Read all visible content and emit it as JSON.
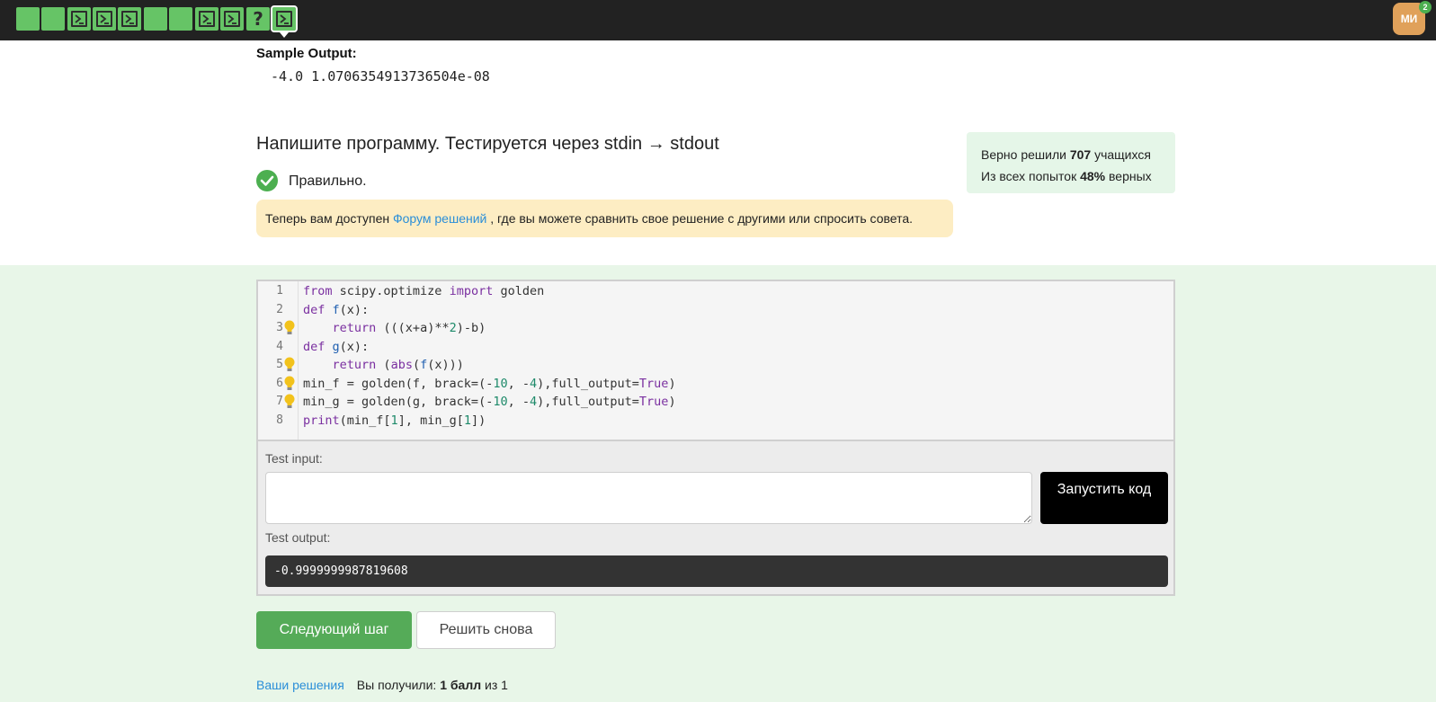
{
  "topbar": {
    "steps": [
      {
        "kind": "text",
        "status": "solved"
      },
      {
        "kind": "text",
        "status": "solved"
      },
      {
        "kind": "code",
        "status": "solved"
      },
      {
        "kind": "code",
        "status": "solved"
      },
      {
        "kind": "code",
        "status": "solved"
      },
      {
        "kind": "text",
        "status": "solved"
      },
      {
        "kind": "text",
        "status": "solved"
      },
      {
        "kind": "code",
        "status": "solved"
      },
      {
        "kind": "code",
        "status": "solved"
      },
      {
        "kind": "quiz",
        "status": "solved",
        "glyph": "?"
      },
      {
        "kind": "code",
        "status": "solved",
        "current": true
      }
    ],
    "avatar_initials": "МИ",
    "notification_count": "2"
  },
  "sample_output": {
    "title": "Sample Output:",
    "value": "-4.0 1.0706354913736504e-08"
  },
  "task": {
    "heading": "Напишите программу. Тестируется через stdin → stdout",
    "status_text": "Правильно."
  },
  "forum_note": {
    "before": "Теперь вам доступен ",
    "link": "Форум решений",
    "after": " , где вы можете сравнить свое решение с другими или спросить совета."
  },
  "stats": {
    "line1_prefix": "Верно решили ",
    "line1_value": "707",
    "line1_suffix": " учащихся",
    "line2_prefix": "Из всех попыток ",
    "line2_value": "48%",
    "line2_suffix": " верных"
  },
  "editor": {
    "line_numbers": [
      "1",
      "2",
      "3",
      "4",
      "5",
      "6",
      "7",
      "8"
    ],
    "lines": [
      "from scipy.optimize import golden",
      "def f(x):",
      "    return (((x+a)**2)-b)",
      "def g(x):",
      "    return (abs(f(x)))",
      "min_f = golden(f, brack=(-10, -4),full_output=True)",
      "min_g = golden(g, brack=(-10, -4),full_output=True)",
      "print(min_f[1], min_g[1])"
    ],
    "hint_lines": [
      3,
      5,
      6,
      7
    ]
  },
  "test": {
    "input_label": "Test input:",
    "input_value": "",
    "run_label": "Запустить код",
    "output_label": "Test output:",
    "output_value": "-0.9999999987819608"
  },
  "actions": {
    "next_label": "Следующий шаг",
    "retry_label": "Решить снова"
  },
  "footer": {
    "solutions_link": "Ваши решения",
    "score_prefix": "Вы получили: ",
    "score_value": "1 балл",
    "score_suffix": " из 1"
  },
  "colors": {
    "topbar": "#222222",
    "step_solved": "#66c466",
    "accent_green": "#55ab58",
    "link": "#2a8ed8",
    "note_bg": "#fdedc3",
    "stats_bg": "#e5f6e8",
    "solution_bg": "#e8f6e8"
  }
}
